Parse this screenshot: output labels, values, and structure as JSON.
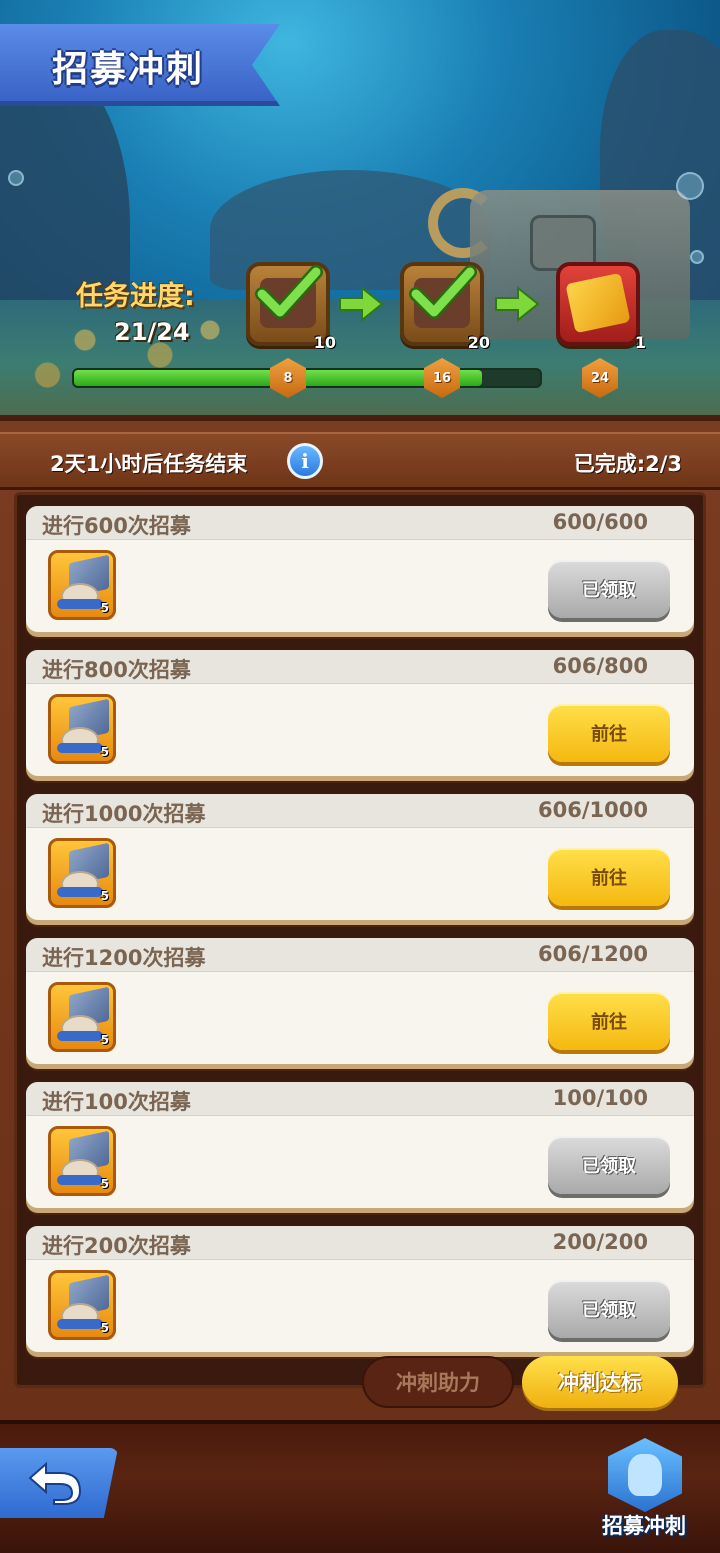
{
  "header": {
    "title": "招募冲刺",
    "progress_label": "任务进度:",
    "progress_value": "21/24",
    "progress_fraction": 0.875,
    "milestones": [
      {
        "threshold": "8",
        "reward_qty": "10",
        "claimed": true
      },
      {
        "threshold": "16",
        "reward_qty": "20",
        "claimed": true
      },
      {
        "threshold": "24",
        "reward_qty": "1",
        "claimed": false
      }
    ]
  },
  "info": {
    "time_left": "2天1小时后任务结束",
    "info_icon": "i",
    "completed": "已完成:2/3"
  },
  "tasks": [
    {
      "name": "进行600次招募",
      "progress": "600/600",
      "reward_qty": "5",
      "button": "已领取",
      "state": "claimed"
    },
    {
      "name": "进行800次招募",
      "progress": "606/800",
      "reward_qty": "5",
      "button": "前往",
      "state": "go"
    },
    {
      "name": "进行1000次招募",
      "progress": "606/1000",
      "reward_qty": "5",
      "button": "前往",
      "state": "go"
    },
    {
      "name": "进行1200次招募",
      "progress": "606/1200",
      "reward_qty": "5",
      "button": "前往",
      "state": "go"
    },
    {
      "name": "进行100次招募",
      "progress": "100/100",
      "reward_qty": "5",
      "button": "已领取",
      "state": "claimed"
    },
    {
      "name": "进行200次招募",
      "progress": "200/200",
      "reward_qty": "5",
      "button": "已领取",
      "state": "claimed"
    }
  ],
  "tabs": [
    {
      "label": "冲刺助力",
      "active": false
    },
    {
      "label": "冲刺达标",
      "active": true
    }
  ],
  "bottom_nav": {
    "recruit_label": "招募冲刺"
  },
  "colors": {
    "accent_yellow": "#f5b811",
    "progress_green": "#2ea81a",
    "board_brown": "#6a3018",
    "title_blue": "#3a63c6"
  }
}
